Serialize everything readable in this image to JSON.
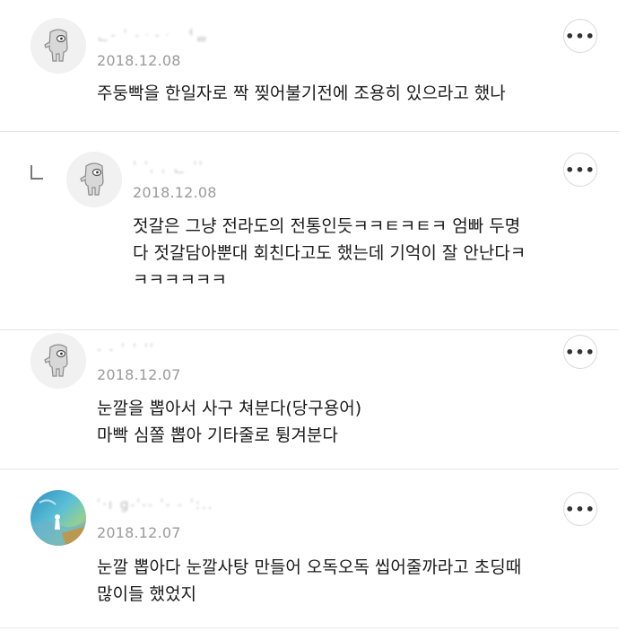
{
  "icons": {
    "more": "more-options-icon",
    "reply": "reply-indent-icon",
    "avatar_default": "default-profile-character-icon",
    "avatar_photo": "watercolor-photo-avatar"
  },
  "comments": [
    {
      "username": "ᆫ˗  ˈ   ˗ᆞ˗ᆞ ᅥᆯ",
      "date": "2018.12.08",
      "text": "주둥빡을 한일자로 짝 찢어불기전에 조용히 있으라고 했나",
      "more_label": "•••",
      "is_reply": false
    },
    {
      "username": "ˈ ˈˌ ˌ ᆫ      ˈˈ",
      "date": "2018.12.08",
      "text": "젓갈은 그냥 전라도의 전통인듯ㅋㅋㅌㅋㅌㅋ 엄빠 두명\n다 젓갈담아뿐대 회친다고도 했는데 기억이 잘 안난다ㅋ\nㅋㅋㅋㅋㅋㅋ",
      "more_label": "•••",
      "is_reply": true
    },
    {
      "username": "˗  ˗    ˈ ˈ ˈˈ",
      "date": "2018.12.07",
      "text": "눈깔을 뽑아서 사구 쳐분다(당구용어)\n마빡 심쫄 뽑아 기타줄로 튕겨분다",
      "more_label": "•••",
      "is_reply": false
    },
    {
      "username": "ˈ·ı  g˗ˈ˗˗      ˈ˗ ˗ ˈ:..",
      "date": "2018.12.07",
      "text": "눈깔 뽑아다 눈깔사탕 만들어 오독오독 씹어줄까라고 초딩때\n많이들 했었지",
      "more_label": "•••",
      "is_reply": false
    }
  ]
}
